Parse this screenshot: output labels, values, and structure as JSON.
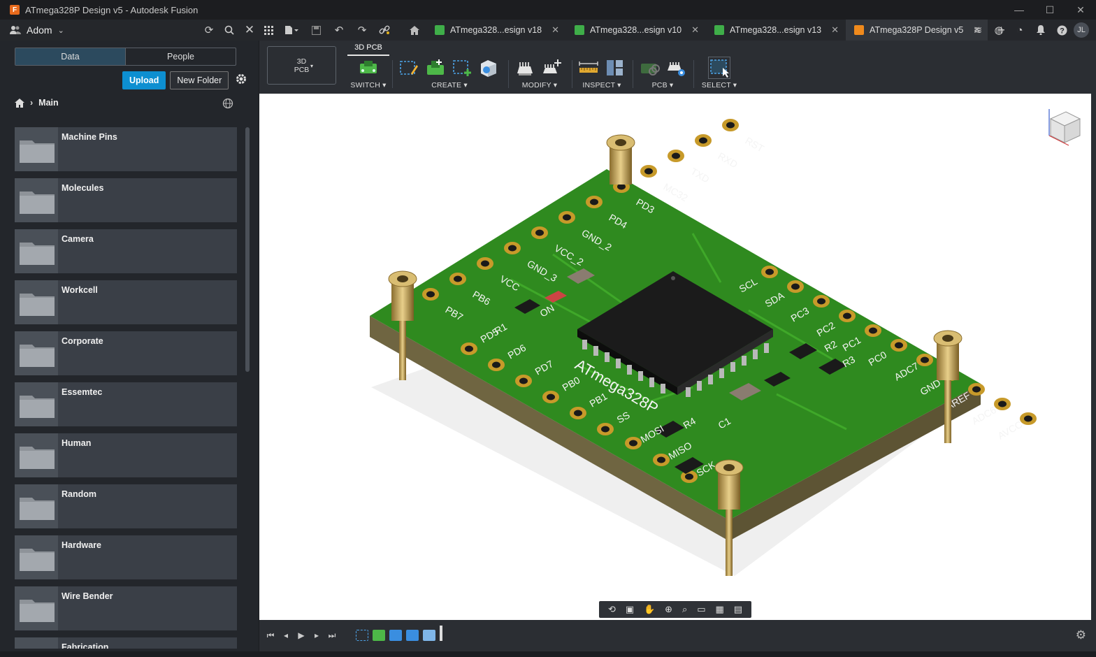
{
  "window": {
    "title": "ATmega328P Design v5 - Autodesk Fusion",
    "controls": {
      "minimize": "—",
      "maximize": "☐",
      "close": "✕"
    }
  },
  "appbar": {
    "team_name": "Adom",
    "user_initials": "JL",
    "tabs": [
      {
        "label": "ATmega328...esign v18",
        "icon_color": "#3fae49",
        "active": false
      },
      {
        "label": "ATmega328...esign v10",
        "icon_color": "#3fae49",
        "active": false
      },
      {
        "label": "ATmega328...esign v13",
        "icon_color": "#3fae49",
        "active": false
      },
      {
        "label": "ATmega328P Design v5",
        "icon_color": "#f08a1c",
        "active": true
      }
    ]
  },
  "data_panel": {
    "segments": {
      "data": "Data",
      "people": "People"
    },
    "upload_label": "Upload",
    "new_folder_label": "New Folder",
    "breadcrumb": "Main",
    "folders": [
      "Machine Pins",
      "Molecules",
      "Camera",
      "Workcell",
      "Corporate",
      "Essemtec",
      "Human",
      "Random",
      "Hardware",
      "Wire Bender",
      "Fabrication"
    ]
  },
  "toolbar": {
    "workspace": {
      "line1": "3D",
      "line2": "PCB"
    },
    "active_tab": "3D PCB",
    "groups": {
      "switch": "SWITCH",
      "create": "CREATE",
      "modify": "MODIFY",
      "inspect": "INSPECT",
      "pcb": "PCB",
      "select": "SELECT"
    }
  },
  "board": {
    "chip_label": "ATmega328P",
    "pin_labels_top": [
      "PB7",
      "PB6",
      "VCC",
      "GND_3",
      "VCC_2",
      "GND_2",
      "PD4",
      "PD3",
      "MC32",
      "TXD",
      "RXD",
      "RST"
    ],
    "pin_labels_left": [
      "PD5",
      "PD6",
      "PD7",
      "PB0",
      "PB1",
      "SS"
    ],
    "pin_labels_right": [
      "SCL",
      "SDA",
      "PC3",
      "PC2",
      "PC1",
      "PC0",
      "ADC7",
      "GND",
      "AREF",
      "ADC6",
      "AVCC"
    ],
    "pin_labels_bottom": [
      "MOSI",
      "MISO",
      "SCK"
    ],
    "component_labels": [
      "R1",
      "R2",
      "R3",
      "R4",
      "C1",
      "ON"
    ]
  },
  "colors": {
    "accent": "#0d8fd1",
    "pcb_green": "#2f8a1f",
    "pad_gold": "#c79a2a",
    "chip_black": "#1b1b1b"
  }
}
